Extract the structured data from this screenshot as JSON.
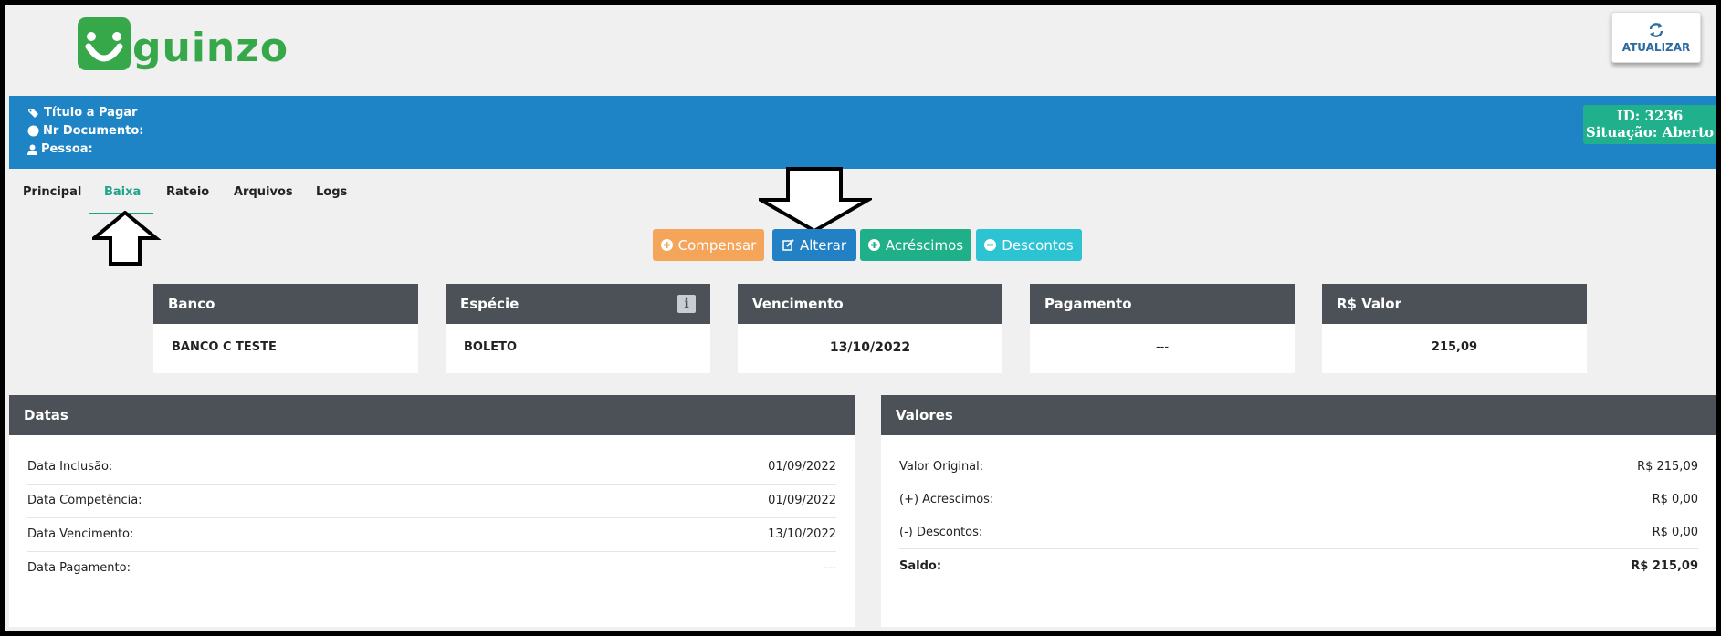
{
  "brand": {
    "logo_text": "guinzo",
    "color": "#36a84a"
  },
  "header": {
    "refresh_label": "ATUALIZAR"
  },
  "record": {
    "title_label": "Título a Pagar",
    "doc_label": "Nr Documento:",
    "person_label": "Pessoa:",
    "id_text": "ID: 3236",
    "status_text": "Situação: Aberto"
  },
  "tabs": [
    {
      "label": "Principal",
      "active": false
    },
    {
      "label": "Baixa",
      "active": true
    },
    {
      "label": "Rateio",
      "active": false
    },
    {
      "label": "Arquivos",
      "active": false
    },
    {
      "label": "Logs",
      "active": false
    }
  ],
  "actions": [
    {
      "label": "Compensar",
      "icon": "plus-circle-icon",
      "color": "#f5a55a"
    },
    {
      "label": "Alterar",
      "icon": "edit-icon",
      "color": "#2281c4"
    },
    {
      "label": "Acréscimos",
      "icon": "plus-circle-icon",
      "color": "#1fb08a"
    },
    {
      "label": "Descontos",
      "icon": "minus-circle-icon",
      "color": "#2cc3d3"
    }
  ],
  "cards": [
    {
      "header": "Banco",
      "value": "BANCO C TESTE"
    },
    {
      "header": "Espécie",
      "value": "BOLETO",
      "info_icon": "i"
    },
    {
      "header": "Vencimento",
      "value": "13/10/2022"
    },
    {
      "header": "Pagamento",
      "value": "---"
    },
    {
      "header": "R$ Valor",
      "value": "215,09"
    }
  ],
  "datas": {
    "title": "Datas",
    "rows": [
      {
        "label": "Data Inclusão:",
        "value": "01/09/2022"
      },
      {
        "label": "Data Competência:",
        "value": "01/09/2022"
      },
      {
        "label": "Data Vencimento:",
        "value": "13/10/2022"
      },
      {
        "label": "Data Pagamento:",
        "value": "---"
      }
    ]
  },
  "valores": {
    "title": "Valores",
    "rows": [
      {
        "label": "Valor Original:",
        "value": "R$ 215,09"
      },
      {
        "label": "(+) Acrescimos:",
        "value": "R$ 0,00"
      },
      {
        "label": "(-) Descontos:",
        "value": "R$ 0,00"
      },
      {
        "label": "Saldo:",
        "value": "R$ 215,09"
      }
    ]
  },
  "colors": {
    "band": "#1f84c6",
    "status_badge": "#20b08c",
    "tab_active": "#1fa488",
    "card_header": "#4b5157"
  }
}
